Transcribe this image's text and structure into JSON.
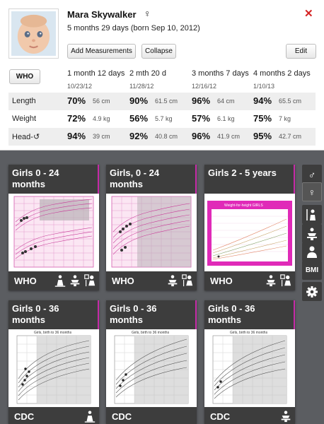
{
  "child": {
    "name": "Mara Skywalker",
    "gender_symbol": "♀",
    "age": "5 months 29 days  (born Sep 10, 2012)"
  },
  "buttons": {
    "add_measurements": "Add Measurements",
    "collapse": "Collapse",
    "edit": "Edit",
    "close": "✕",
    "standard": "WHO"
  },
  "visits": [
    {
      "label": "1 month 12 days",
      "date": "10/23/12"
    },
    {
      "label": "2 mth 20 d",
      "date": "11/28/12"
    },
    {
      "label": "3 months 7 days",
      "date": "12/16/12"
    },
    {
      "label": "4 months 2 days",
      "date": "1/10/13"
    }
  ],
  "measurements": [
    {
      "label": "Length",
      "cells": [
        {
          "pct": "70%",
          "val": "56 cm"
        },
        {
          "pct": "90%",
          "val": "61.5 cm"
        },
        {
          "pct": "96%",
          "val": "64 cm"
        },
        {
          "pct": "94%",
          "val": "65.5 cm"
        }
      ]
    },
    {
      "label": "Weight",
      "cells": [
        {
          "pct": "72%",
          "val": "4.9 kg"
        },
        {
          "pct": "56%",
          "val": "5.7 kg"
        },
        {
          "pct": "57%",
          "val": "6.1 kg"
        },
        {
          "pct": "75%",
          "val": "7 kg"
        }
      ]
    },
    {
      "label": "Head-↺",
      "cells": [
        {
          "pct": "94%",
          "val": "39 cm"
        },
        {
          "pct": "92%",
          "val": "40.8 cm"
        },
        {
          "pct": "96%",
          "val": "41.9 cm"
        },
        {
          "pct": "95%",
          "val": "42.7 cm"
        }
      ]
    }
  ],
  "charts": [
    {
      "title": "Girls 0 - 24 months",
      "org": "WHO",
      "icons": [
        "length-icon",
        "weight-icon",
        "head-circumference-icon"
      ]
    },
    {
      "title": "Girls, 0 - 24 months",
      "org": "WHO",
      "icons": [
        "weight-icon",
        "head-circumference-icon"
      ]
    },
    {
      "title": "Girls 2 - 5 years",
      "org": "WHO",
      "icons": [
        "weight-icon",
        "head-circumference-icon"
      ],
      "chart_heading": "Weight-for-height GIRLS"
    },
    {
      "title": "Girls 0 - 36 months",
      "org": "CDC",
      "icons": [
        "length-icon"
      ],
      "chart_heading": "Girls, birth to 36 months"
    },
    {
      "title": "Girls 0 - 36 months",
      "org": "CDC",
      "icons": [],
      "chart_heading": "Girls, birth to 36 months"
    },
    {
      "title": "Girls 0 - 36 months",
      "org": "CDC",
      "icons": [
        "weight-icon"
      ],
      "chart_heading": "Girls, birth to 36 months"
    }
  ],
  "sidebar": [
    {
      "name": "male-filter",
      "icon": "male-icon",
      "symbol": "♂"
    },
    {
      "name": "female-filter",
      "icon": "female-icon",
      "symbol": "♀"
    },
    {
      "name": "length-filter",
      "icon": "length-icon"
    },
    {
      "name": "weight-filter",
      "icon": "weight-icon"
    },
    {
      "name": "person-filter",
      "icon": "person-icon"
    },
    {
      "name": "bmi-filter",
      "icon": "bmi-icon",
      "symbol": "BMI"
    },
    {
      "name": "settings",
      "icon": "gear-icon"
    }
  ],
  "colors": {
    "accent_pink": "#c62aa7",
    "close_red": "#d42121",
    "dark_card": "#3d3d3d",
    "background": "#5b5d61"
  }
}
